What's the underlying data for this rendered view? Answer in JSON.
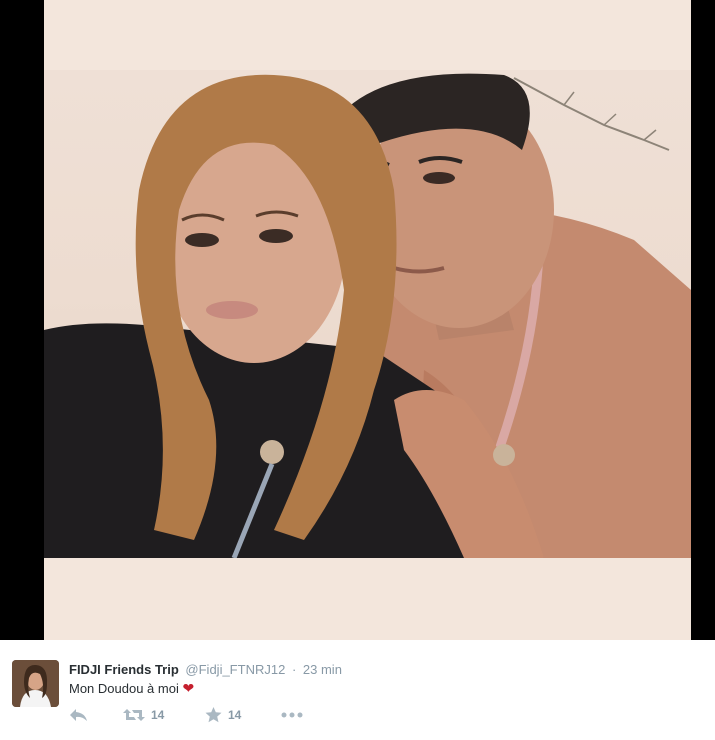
{
  "tweet": {
    "author_name": "FIDJI Friends Trip",
    "author_handle": "@Fidji_FTNRJ12",
    "separator": "·",
    "timestamp": "23 min",
    "text": "Mon Doudou à moi",
    "emoji": "❤",
    "avatar": "author-avatar",
    "media": "selfie-photo"
  },
  "actions": {
    "reply": {
      "icon": "reply-icon"
    },
    "retweet": {
      "icon": "retweet-icon",
      "count": "14"
    },
    "favorite": {
      "icon": "star-icon",
      "count": "14"
    },
    "more": {
      "icon": "more-icon"
    }
  },
  "colors": {
    "name": "#292f33",
    "meta": "#8899a6",
    "action_icon": "#aab8c2",
    "heart": "#c51f2e",
    "frame": "#000000"
  }
}
